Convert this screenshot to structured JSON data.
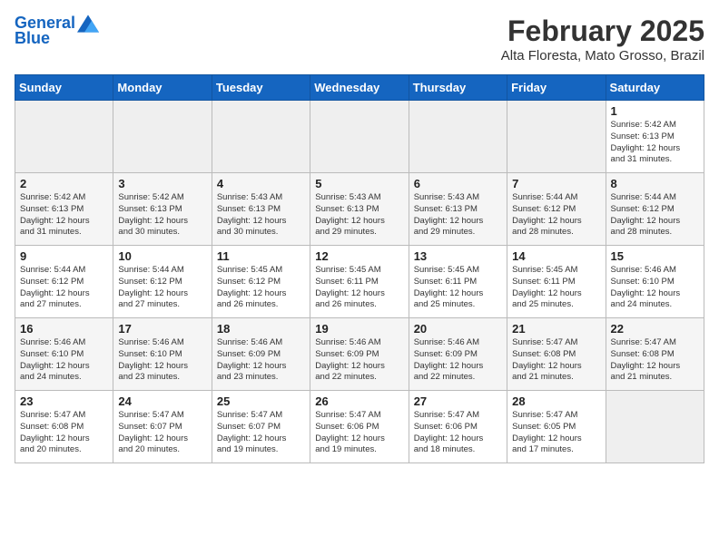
{
  "header": {
    "logo_line1": "General",
    "logo_line2": "Blue",
    "title": "February 2025",
    "subtitle": "Alta Floresta, Mato Grosso, Brazil"
  },
  "weekdays": [
    "Sunday",
    "Monday",
    "Tuesday",
    "Wednesday",
    "Thursday",
    "Friday",
    "Saturday"
  ],
  "weeks": [
    [
      {
        "empty": true
      },
      {
        "empty": true
      },
      {
        "empty": true
      },
      {
        "empty": true
      },
      {
        "empty": true
      },
      {
        "empty": true
      },
      {
        "num": "1",
        "info": "Sunrise: 5:42 AM\nSunset: 6:13 PM\nDaylight: 12 hours\nand 31 minutes."
      }
    ],
    [
      {
        "num": "2",
        "info": "Sunrise: 5:42 AM\nSunset: 6:13 PM\nDaylight: 12 hours\nand 31 minutes."
      },
      {
        "num": "3",
        "info": "Sunrise: 5:42 AM\nSunset: 6:13 PM\nDaylight: 12 hours\nand 30 minutes."
      },
      {
        "num": "4",
        "info": "Sunrise: 5:43 AM\nSunset: 6:13 PM\nDaylight: 12 hours\nand 30 minutes."
      },
      {
        "num": "5",
        "info": "Sunrise: 5:43 AM\nSunset: 6:13 PM\nDaylight: 12 hours\nand 29 minutes."
      },
      {
        "num": "6",
        "info": "Sunrise: 5:43 AM\nSunset: 6:13 PM\nDaylight: 12 hours\nand 29 minutes."
      },
      {
        "num": "7",
        "info": "Sunrise: 5:44 AM\nSunset: 6:12 PM\nDaylight: 12 hours\nand 28 minutes."
      },
      {
        "num": "8",
        "info": "Sunrise: 5:44 AM\nSunset: 6:12 PM\nDaylight: 12 hours\nand 28 minutes."
      }
    ],
    [
      {
        "num": "9",
        "info": "Sunrise: 5:44 AM\nSunset: 6:12 PM\nDaylight: 12 hours\nand 27 minutes."
      },
      {
        "num": "10",
        "info": "Sunrise: 5:44 AM\nSunset: 6:12 PM\nDaylight: 12 hours\nand 27 minutes."
      },
      {
        "num": "11",
        "info": "Sunrise: 5:45 AM\nSunset: 6:12 PM\nDaylight: 12 hours\nand 26 minutes."
      },
      {
        "num": "12",
        "info": "Sunrise: 5:45 AM\nSunset: 6:11 PM\nDaylight: 12 hours\nand 26 minutes."
      },
      {
        "num": "13",
        "info": "Sunrise: 5:45 AM\nSunset: 6:11 PM\nDaylight: 12 hours\nand 25 minutes."
      },
      {
        "num": "14",
        "info": "Sunrise: 5:45 AM\nSunset: 6:11 PM\nDaylight: 12 hours\nand 25 minutes."
      },
      {
        "num": "15",
        "info": "Sunrise: 5:46 AM\nSunset: 6:10 PM\nDaylight: 12 hours\nand 24 minutes."
      }
    ],
    [
      {
        "num": "16",
        "info": "Sunrise: 5:46 AM\nSunset: 6:10 PM\nDaylight: 12 hours\nand 24 minutes."
      },
      {
        "num": "17",
        "info": "Sunrise: 5:46 AM\nSunset: 6:10 PM\nDaylight: 12 hours\nand 23 minutes."
      },
      {
        "num": "18",
        "info": "Sunrise: 5:46 AM\nSunset: 6:09 PM\nDaylight: 12 hours\nand 23 minutes."
      },
      {
        "num": "19",
        "info": "Sunrise: 5:46 AM\nSunset: 6:09 PM\nDaylight: 12 hours\nand 22 minutes."
      },
      {
        "num": "20",
        "info": "Sunrise: 5:46 AM\nSunset: 6:09 PM\nDaylight: 12 hours\nand 22 minutes."
      },
      {
        "num": "21",
        "info": "Sunrise: 5:47 AM\nSunset: 6:08 PM\nDaylight: 12 hours\nand 21 minutes."
      },
      {
        "num": "22",
        "info": "Sunrise: 5:47 AM\nSunset: 6:08 PM\nDaylight: 12 hours\nand 21 minutes."
      }
    ],
    [
      {
        "num": "23",
        "info": "Sunrise: 5:47 AM\nSunset: 6:08 PM\nDaylight: 12 hours\nand 20 minutes."
      },
      {
        "num": "24",
        "info": "Sunrise: 5:47 AM\nSunset: 6:07 PM\nDaylight: 12 hours\nand 20 minutes."
      },
      {
        "num": "25",
        "info": "Sunrise: 5:47 AM\nSunset: 6:07 PM\nDaylight: 12 hours\nand 19 minutes."
      },
      {
        "num": "26",
        "info": "Sunrise: 5:47 AM\nSunset: 6:06 PM\nDaylight: 12 hours\nand 19 minutes."
      },
      {
        "num": "27",
        "info": "Sunrise: 5:47 AM\nSunset: 6:06 PM\nDaylight: 12 hours\nand 18 minutes."
      },
      {
        "num": "28",
        "info": "Sunrise: 5:47 AM\nSunset: 6:05 PM\nDaylight: 12 hours\nand 17 minutes."
      },
      {
        "empty": true
      }
    ]
  ]
}
